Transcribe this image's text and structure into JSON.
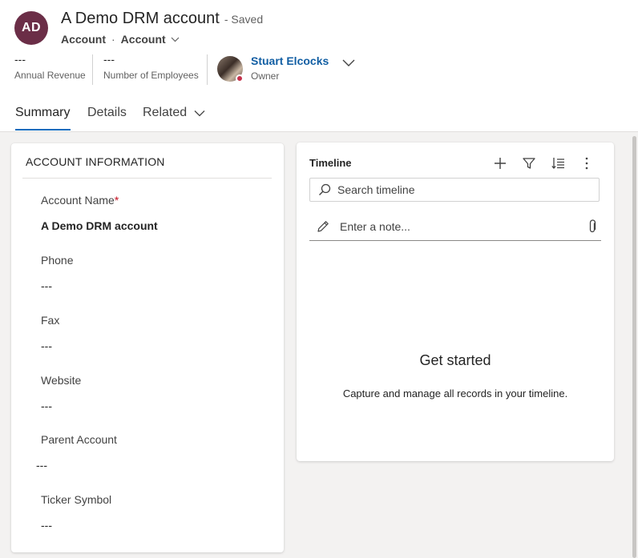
{
  "header": {
    "avatar_initials": "AD",
    "avatar_color": "#6b2e47",
    "record_title": "A Demo DRM account",
    "saved_status": "- Saved",
    "entity": "Account",
    "separator": "·",
    "form_selector": "Account"
  },
  "kpis": [
    {
      "value": "---",
      "label": "Annual Revenue"
    },
    {
      "value": "---",
      "label": "Number of Employees"
    }
  ],
  "owner": {
    "name": "Stuart Elcocks",
    "label": "Owner",
    "presence_color": "#c4314b"
  },
  "tabs": [
    {
      "label": "Summary",
      "active": true
    },
    {
      "label": "Details",
      "active": false
    },
    {
      "label": "Related",
      "active": false
    }
  ],
  "account_info": {
    "section_title": "ACCOUNT INFORMATION",
    "fields": [
      {
        "label": "Account Name",
        "required_marker": "*",
        "value": "A Demo DRM account"
      },
      {
        "label": "Phone",
        "value": "---"
      },
      {
        "label": "Fax",
        "value": "---"
      },
      {
        "label": "Website",
        "value": "---"
      },
      {
        "label": "Parent Account",
        "value": "---"
      },
      {
        "label": "Ticker Symbol",
        "value": "---"
      }
    ]
  },
  "timeline": {
    "title": "Timeline",
    "tools": [
      "plus-icon",
      "filter-icon",
      "sort-icon",
      "more-icon"
    ],
    "search_placeholder": "Search timeline",
    "note_placeholder": "Enter a note...",
    "empty_title": "Get started",
    "empty_subtitle": "Capture and manage all records in your timeline."
  },
  "colors": {
    "accent": "#0f6cbd",
    "link": "#115ea3",
    "required": "#c50f1f"
  }
}
